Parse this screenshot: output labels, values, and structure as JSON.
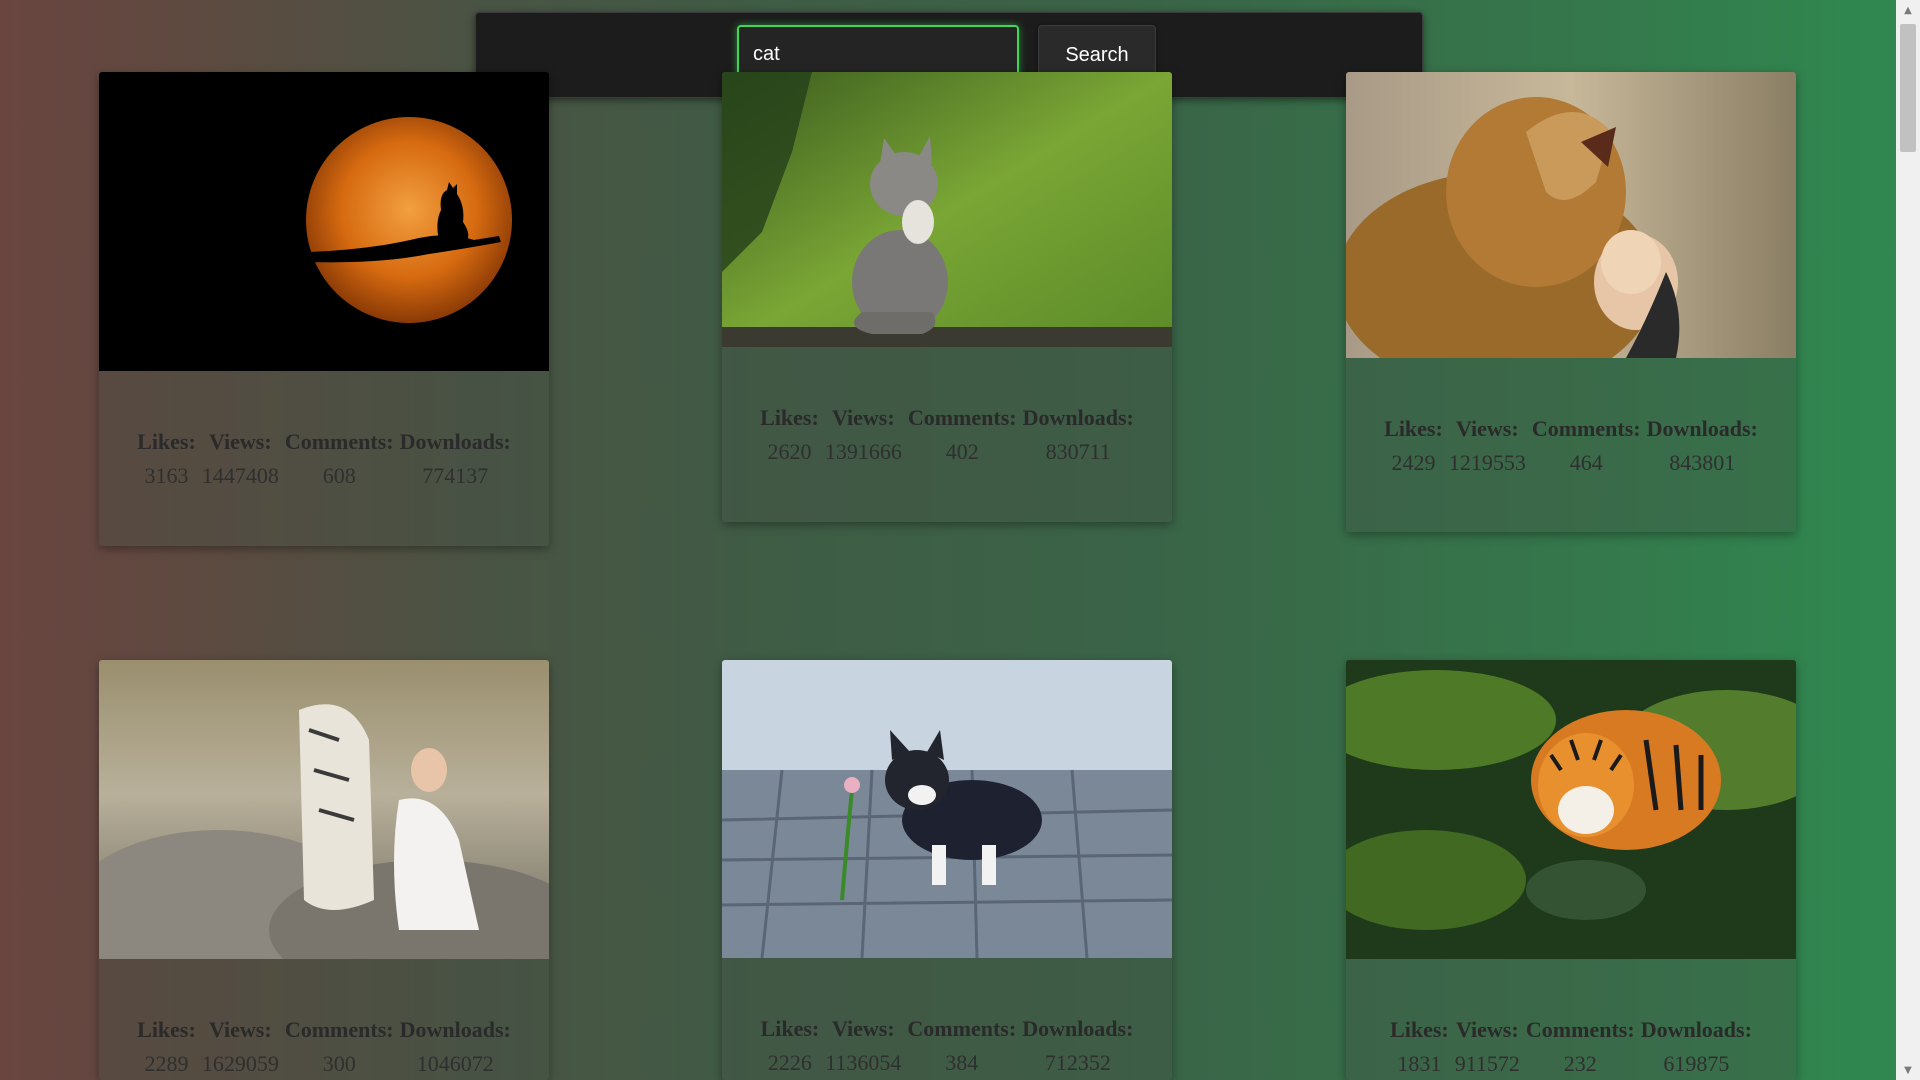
{
  "search": {
    "value": "cat",
    "button_label": "Search"
  },
  "stat_labels": {
    "likes": "Likes:",
    "views": "Views:",
    "comments": "Comments:",
    "downloads": "Downloads:"
  },
  "cards": [
    {
      "image": "cat-silhouette-on-branch-against-orange-moon",
      "likes": "3163",
      "views": "1447408",
      "comments": "608",
      "downloads": "774137"
    },
    {
      "image": "grey-kitten-sitting-in-green-forest",
      "likes": "2620",
      "views": "1391666",
      "comments": "402",
      "downloads": "830711"
    },
    {
      "image": "lion-roaring-with-smiling-girl",
      "likes": "2429",
      "views": "1219553",
      "comments": "464",
      "downloads": "843801"
    },
    {
      "image": "white-tiger-with-woman-in-white-dress",
      "likes": "2289",
      "views": "1629059",
      "comments": "300",
      "downloads": "1046072"
    },
    {
      "image": "black-white-kitten-playing-with-flower",
      "likes": "2226",
      "views": "1136054",
      "comments": "384",
      "downloads": "712352"
    },
    {
      "image": "tiger-swimming-in-green-water",
      "likes": "1831",
      "views": "911572",
      "comments": "232",
      "downloads": "619875"
    }
  ],
  "scrollbar": {
    "up_arrow": "▲",
    "down_arrow": "▼"
  }
}
